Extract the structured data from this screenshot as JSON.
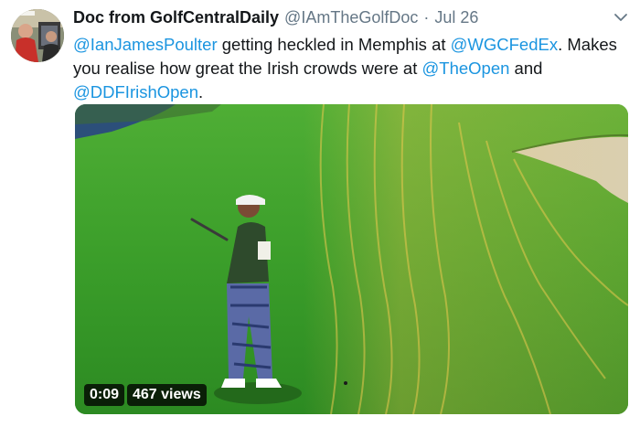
{
  "tweet": {
    "display_name": "Doc from GolfCentralDaily",
    "handle": "@IAmTheGolfDoc",
    "separator": "·",
    "date": "Jul 26",
    "text": {
      "mention_1": "@IanJamesPoulter",
      "part_1": " getting heckled in Memphis at ",
      "mention_2": "@WGCFedEx",
      "part_2": ".  Makes you realise how great the Irish crowds were at ",
      "mention_3": "@TheOpen",
      "part_3": " and ",
      "mention_4": "@DDFIrishOpen",
      "part_4": "."
    }
  },
  "video": {
    "duration": "0:09",
    "views": "467 views"
  },
  "icons": {
    "menu": "chevron-down-icon",
    "avatar": "avatar-image"
  },
  "colors": {
    "link": "#1b95e0",
    "secondary_text": "#657786",
    "primary_text": "#14171a"
  }
}
